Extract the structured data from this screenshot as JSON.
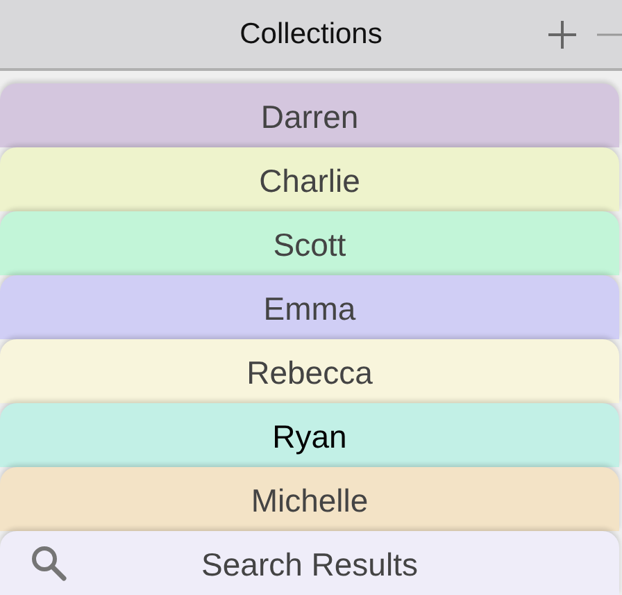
{
  "header": {
    "title": "Collections"
  },
  "collections": [
    {
      "kind": "collection",
      "label": "Darren",
      "color": "#d4c6de",
      "selected": false
    },
    {
      "kind": "collection",
      "label": "Charlie",
      "color": "#eef3cc",
      "selected": false
    },
    {
      "kind": "collection",
      "label": "Scott",
      "color": "#c2f5d8",
      "selected": false
    },
    {
      "kind": "collection",
      "label": "Emma",
      "color": "#d0cef5",
      "selected": false
    },
    {
      "kind": "collection",
      "label": "Rebecca",
      "color": "#f8f5dc",
      "selected": false
    },
    {
      "kind": "collection",
      "label": "Ryan",
      "color": "#c2f0e6",
      "selected": true
    },
    {
      "kind": "collection",
      "label": "Michelle",
      "color": "#f3e3c6",
      "selected": false
    },
    {
      "kind": "search",
      "label": "Search Results",
      "color": "#efedf9",
      "selected": false
    }
  ]
}
